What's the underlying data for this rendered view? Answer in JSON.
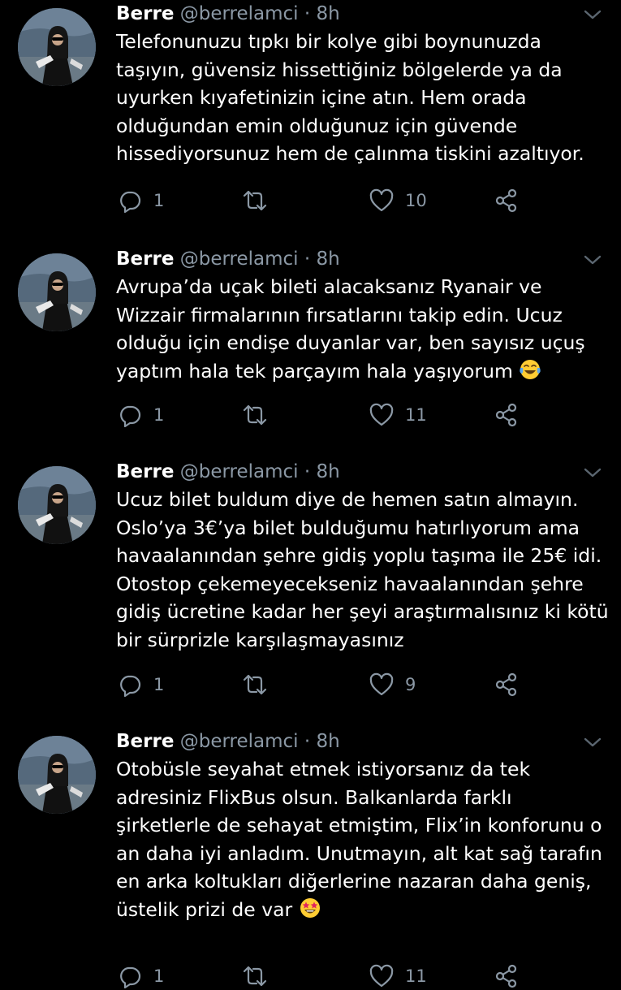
{
  "tweets": [
    {
      "name": "Berre",
      "handle": "@berrelamci",
      "dot": "·",
      "time": "8h",
      "text": "Telefonunuzu tıpkı bir kolye gibi boynunuzda taşıyın, güvensiz hissettiğiniz bölgelerde ya da uyurken kıyafetinizin içine atın. Hem orada olduğundan emin olduğunuz için güvende hissediyorsunuz hem de çalınma tiskini azaltıyor.",
      "emoji": "",
      "reply_count": "1",
      "retweet_count": "",
      "like_count": "10"
    },
    {
      "name": "Berre",
      "handle": "@berrelamci",
      "dot": "·",
      "time": "8h",
      "text": "Avrupa’da uçak bileti alacaksanız Ryanair ve Wizzair firmalarının fırsatlarını takip edin. Ucuz olduğu için endişe duyanlar var, ben sayısız uçuş yaptım hala tek parçayım hala yaşıyorum",
      "emoji": "tears-of-joy",
      "reply_count": "1",
      "retweet_count": "",
      "like_count": "11"
    },
    {
      "name": "Berre",
      "handle": "@berrelamci",
      "dot": "·",
      "time": "8h",
      "text": "Ucuz bilet buldum diye de hemen satın almayın. Oslo’ya 3€’ya bilet bulduğumu hatırlıyorum ama havaalanından şehre gidiş yoplu taşıma ile 25€ idi. Otostop çekemeyecekseniz havaalanından şehre gidiş ücretine kadar her şeyi araştırmalısınız ki kötü bir sürprizle karşılaşmayasınız",
      "emoji": "",
      "reply_count": "1",
      "retweet_count": "",
      "like_count": "9"
    },
    {
      "name": "Berre",
      "handle": "@berrelamci",
      "dot": "·",
      "time": "8h",
      "text": "Otobüsle seyahat etmek istiyorsanız da tek adresiniz FlixBus olsun. Balkanlarda farklı şirketlerle de sehayat etmiştim, Flix’in konforunu o an daha iyi anladım. Unutmayın, alt kat sağ tarafın en arka koltukları diğerlerine nazaran daha geniş, üstelik prizi de var",
      "emoji": "star-struck",
      "reply_count": "1",
      "retweet_count": "",
      "like_count": "11"
    }
  ],
  "icons": {
    "reply": "reply-icon",
    "retweet": "retweet-icon",
    "like": "like-icon",
    "share": "share-icon",
    "more": "chevron-down-icon"
  },
  "colors": {
    "background": "#000000",
    "text": "#ffffff",
    "secondary": "#8b98a5",
    "emoji_face": "#ffcc33"
  }
}
